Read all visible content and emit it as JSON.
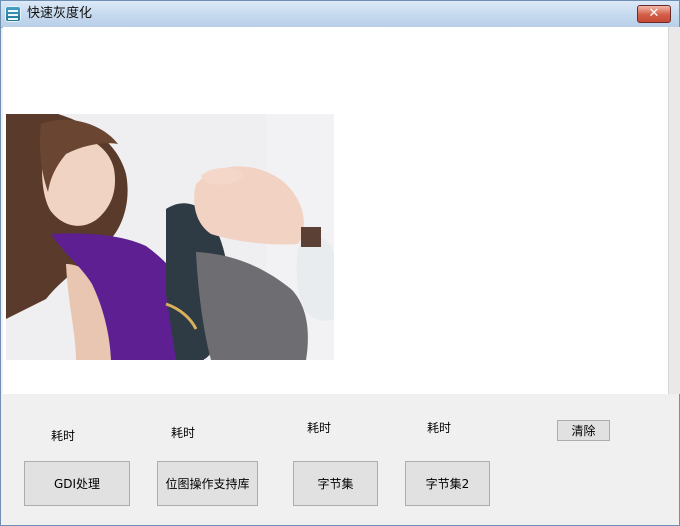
{
  "window": {
    "title": "快速灰度化",
    "close_symbol": "✕"
  },
  "image": {
    "description_icon": "photo-icon"
  },
  "labels": {
    "time1": "耗时",
    "time2": "耗时",
    "time3": "耗时",
    "time4": "耗时"
  },
  "buttons": {
    "clear": "清除",
    "gdi": "GDI处理",
    "bitmap": "位图操作支持库",
    "byteset": "字节集",
    "byteset2": "字节集2"
  }
}
